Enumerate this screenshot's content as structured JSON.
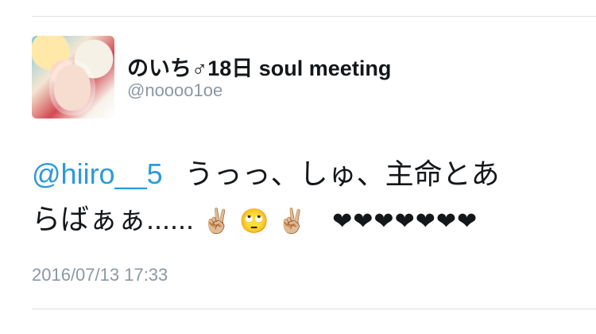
{
  "user": {
    "display_name": "のいち♂18日 soul meeting",
    "handle": "@noooo1oe"
  },
  "tweet": {
    "mention": "@hiiro__5",
    "text_line1": "うっっ、しゅ、主命とあ",
    "text_line2": "らばぁぁ......",
    "emoji_1": "✌🏼",
    "emoji_2": "🙄",
    "emoji_3": "✌🏼",
    "hearts": "❤❤❤❤❤❤❤"
  },
  "timestamp": "2016/07/13 17:33",
  "colors": {
    "mention": "#2b9ad9",
    "muted_text": "#8a98a5",
    "divider": "#dcdfe3"
  },
  "icons": {
    "avatar": "user-avatar-photo"
  }
}
